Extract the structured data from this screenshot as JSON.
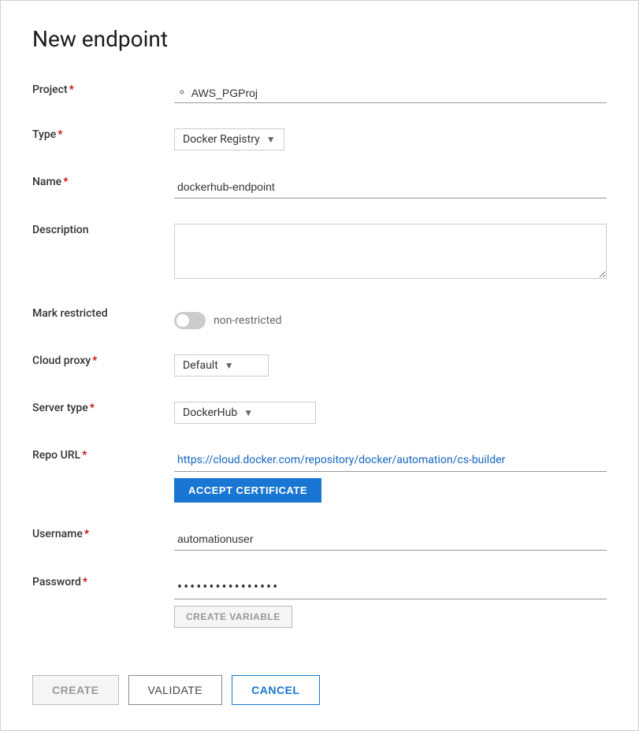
{
  "page": {
    "title": "New endpoint"
  },
  "form": {
    "project_label": "Project",
    "project_value": "AWS_PGProj",
    "type_label": "Type",
    "type_value": "Docker Registry",
    "name_label": "Name",
    "name_value": "dockerhub-endpoint",
    "description_label": "Description",
    "description_value": "",
    "description_placeholder": "",
    "mark_restricted_label": "Mark restricted",
    "toggle_label": "non-restricted",
    "cloud_proxy_label": "Cloud proxy",
    "cloud_proxy_value": "Default",
    "server_type_label": "Server type",
    "server_type_value": "DockerHub",
    "repo_url_label": "Repo URL",
    "repo_url_value": "https://cloud.docker.com/repository/docker/automation/cs-builder",
    "accept_cert_label": "ACCEPT CERTIFICATE",
    "username_label": "Username",
    "username_value": "automationuser",
    "password_label": "Password",
    "password_dots": "••••••••••••••••",
    "create_variable_label": "CREATE VARIABLE"
  },
  "footer": {
    "create_label": "CREATE",
    "validate_label": "VALIDATE",
    "cancel_label": "CANCEL"
  },
  "icons": {
    "search": "🔍",
    "chevron_down": "▾"
  }
}
